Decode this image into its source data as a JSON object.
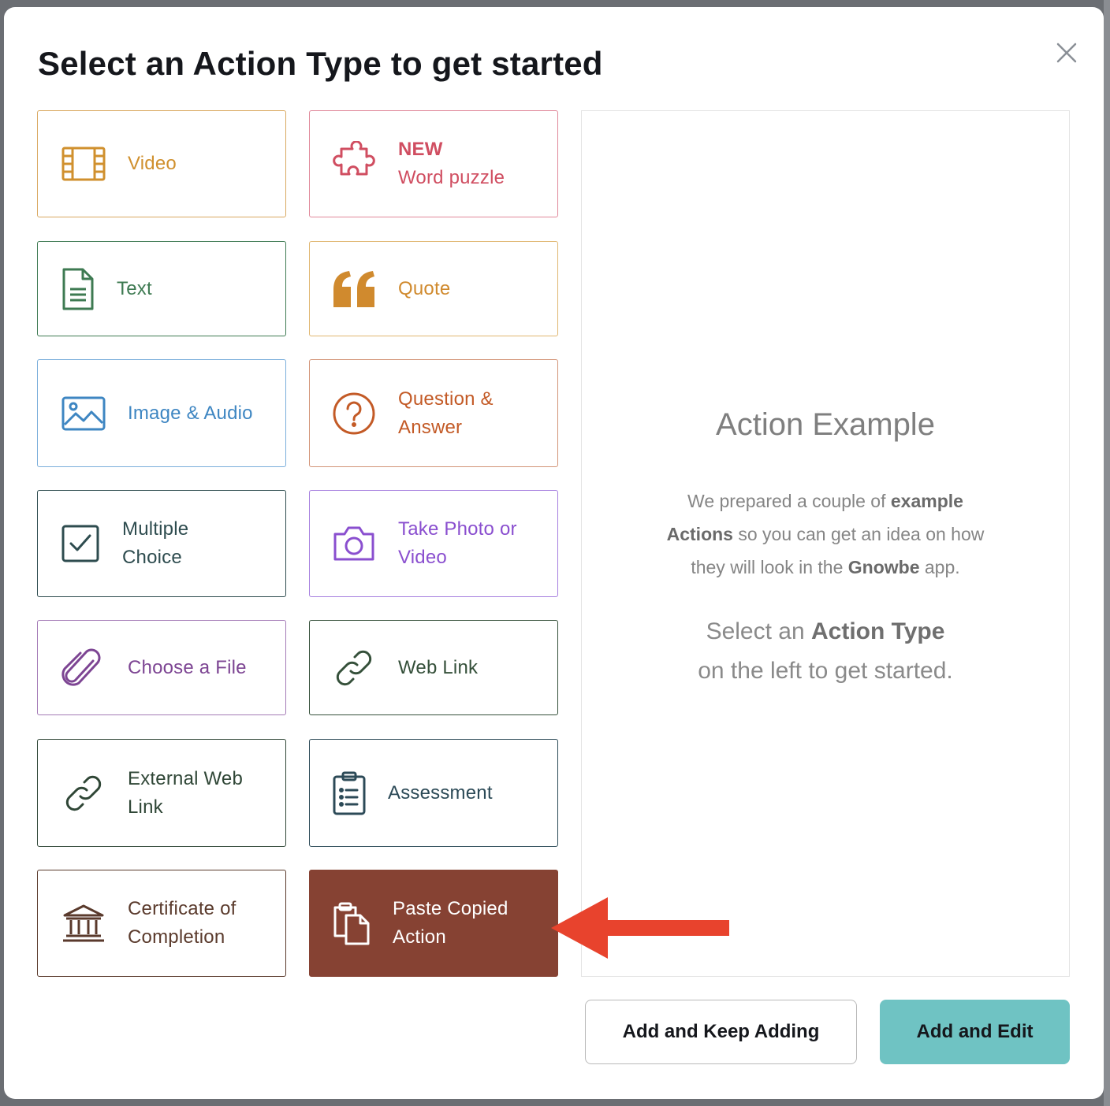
{
  "modal": {
    "title": "Select an Action Type to get started"
  },
  "action_types": {
    "video": {
      "label": "Video",
      "color": "#d0902e"
    },
    "word_puzzle": {
      "badge": "NEW",
      "label": "Word puzzle",
      "color": "#d04e61"
    },
    "text": {
      "label": "Text",
      "color": "#3e7a52"
    },
    "quote": {
      "label": "Quote",
      "color": "#d08a2e"
    },
    "image_audio": {
      "label": "Image & Audio",
      "color": "#3e86c2"
    },
    "question_answer": {
      "label_1": "Question &",
      "label_2": "Answer",
      "color": "#c35a26"
    },
    "multiple_choice": {
      "label_1": "Multiple",
      "label_2": "Choice",
      "color": "#2e4c4f"
    },
    "take_photo": {
      "label_1": "Take Photo or",
      "label_2": "Video",
      "color": "#8a4fcf"
    },
    "choose_file": {
      "label": "Choose a File",
      "color": "#7d4593"
    },
    "web_link": {
      "label": "Web Link",
      "color": "#35503a"
    },
    "external_web_link": {
      "label_1": "External Web",
      "label_2": "Link",
      "color": "#2f4636"
    },
    "assessment": {
      "label": "Assessment",
      "color": "#2c4a57"
    },
    "certificate": {
      "label_1": "Certificate of",
      "label_2": "Completion",
      "color": "#5a3a2c"
    },
    "paste_copied": {
      "label_1": "Paste Copied",
      "label_2": "Action",
      "color": "#864233"
    }
  },
  "preview": {
    "title": "Action Example",
    "desc_1": "We prepared a couple of ",
    "desc_1b": "example",
    "desc_2b": "Actions",
    "desc_2": " so you can get an idea on how",
    "desc_3": "they will look in the ",
    "desc_3b": "Gnowbe",
    "desc_3c": " app.",
    "hint_1": "Select an ",
    "hint_1b": "Action Type",
    "hint_2": "on the left to get started."
  },
  "footer": {
    "keep_adding_label": "Add and Keep Adding",
    "edit_label": "Add and Edit"
  },
  "colors": {
    "selected_bg": "#864233",
    "primary_button": "#6fc3c3",
    "arrow": "#e8432d"
  }
}
